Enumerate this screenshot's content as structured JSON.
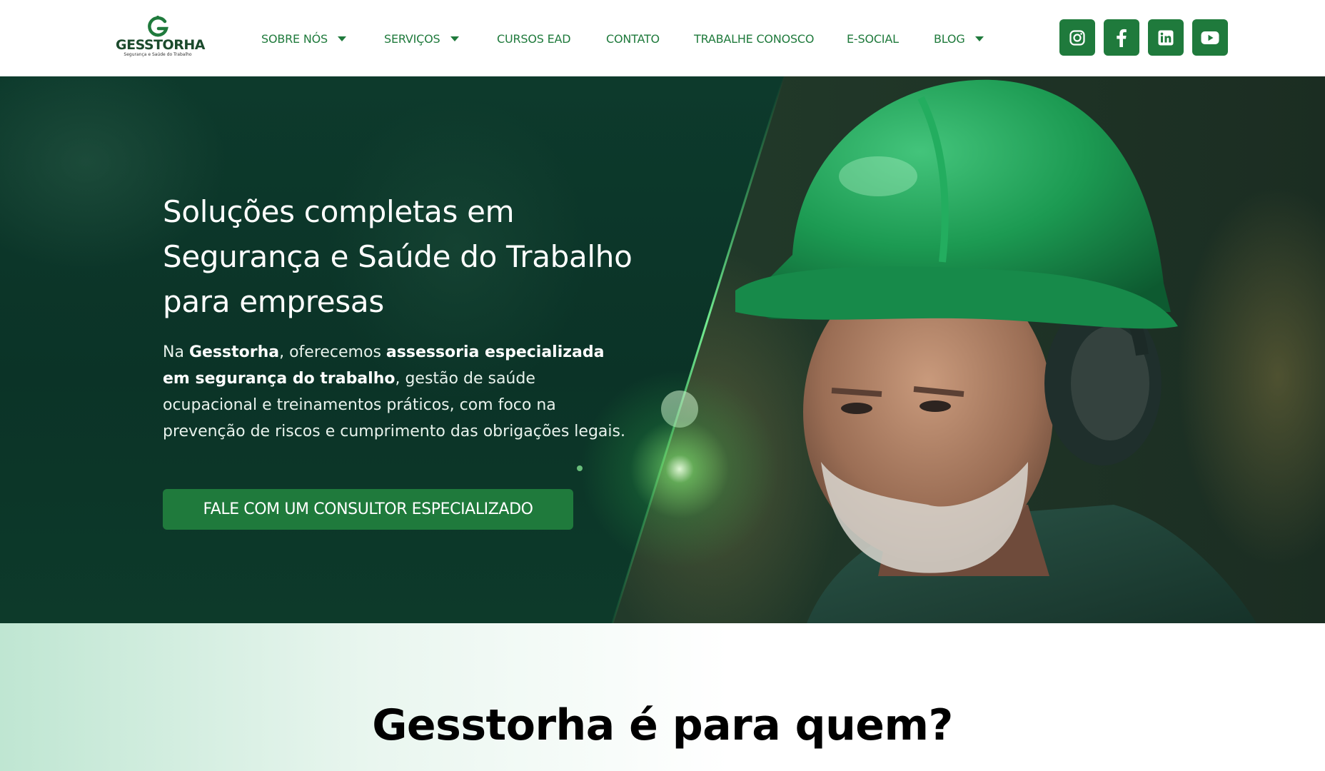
{
  "header": {
    "logo": {
      "letter": "G",
      "name": "GESSTORHA",
      "tagline": "Segurança e Saúde do Trabalho"
    },
    "nav": [
      {
        "label": "SOBRE NÓS",
        "has_dropdown": true
      },
      {
        "label": "SERVIÇOS",
        "has_dropdown": true
      },
      {
        "label": "CURSOS EAD",
        "has_dropdown": false
      },
      {
        "label": "CONTATO",
        "has_dropdown": false
      },
      {
        "label": "TRABALHE CONOSCO",
        "has_dropdown": false
      },
      {
        "label": "E-SOCIAL",
        "has_dropdown": false
      },
      {
        "label": "BLOG",
        "has_dropdown": true
      }
    ],
    "socials": [
      "instagram-icon",
      "facebook-icon",
      "linkedin-icon",
      "youtube-icon"
    ]
  },
  "hero": {
    "title_line1": "Soluções completas em",
    "title_line2": "Segurança e Saúde do Trabalho",
    "title_line3": "para empresas",
    "text": {
      "p1": "Na ",
      "b1": "Gesstorha",
      "p2": ", oferecemos ",
      "b2": "assessoria especializada em segurança do trabalho",
      "p3": ", gestão de saúde ocupacional e treinamentos práticos, com foco na prevenção de riscos e cumprimento das obrigações legais."
    },
    "cta_label": "FALE COM UM CONSULTOR ESPECIALIZADO",
    "image": "worker-green-helmet-ear-protection"
  },
  "section2": {
    "title_strong": "Gesstorha",
    "title_rest": " é para quem?"
  },
  "colors": {
    "brand_green": "#1f7a3c",
    "hero_dark": "#0b3327",
    "helmet_green": "#1fa05a"
  }
}
